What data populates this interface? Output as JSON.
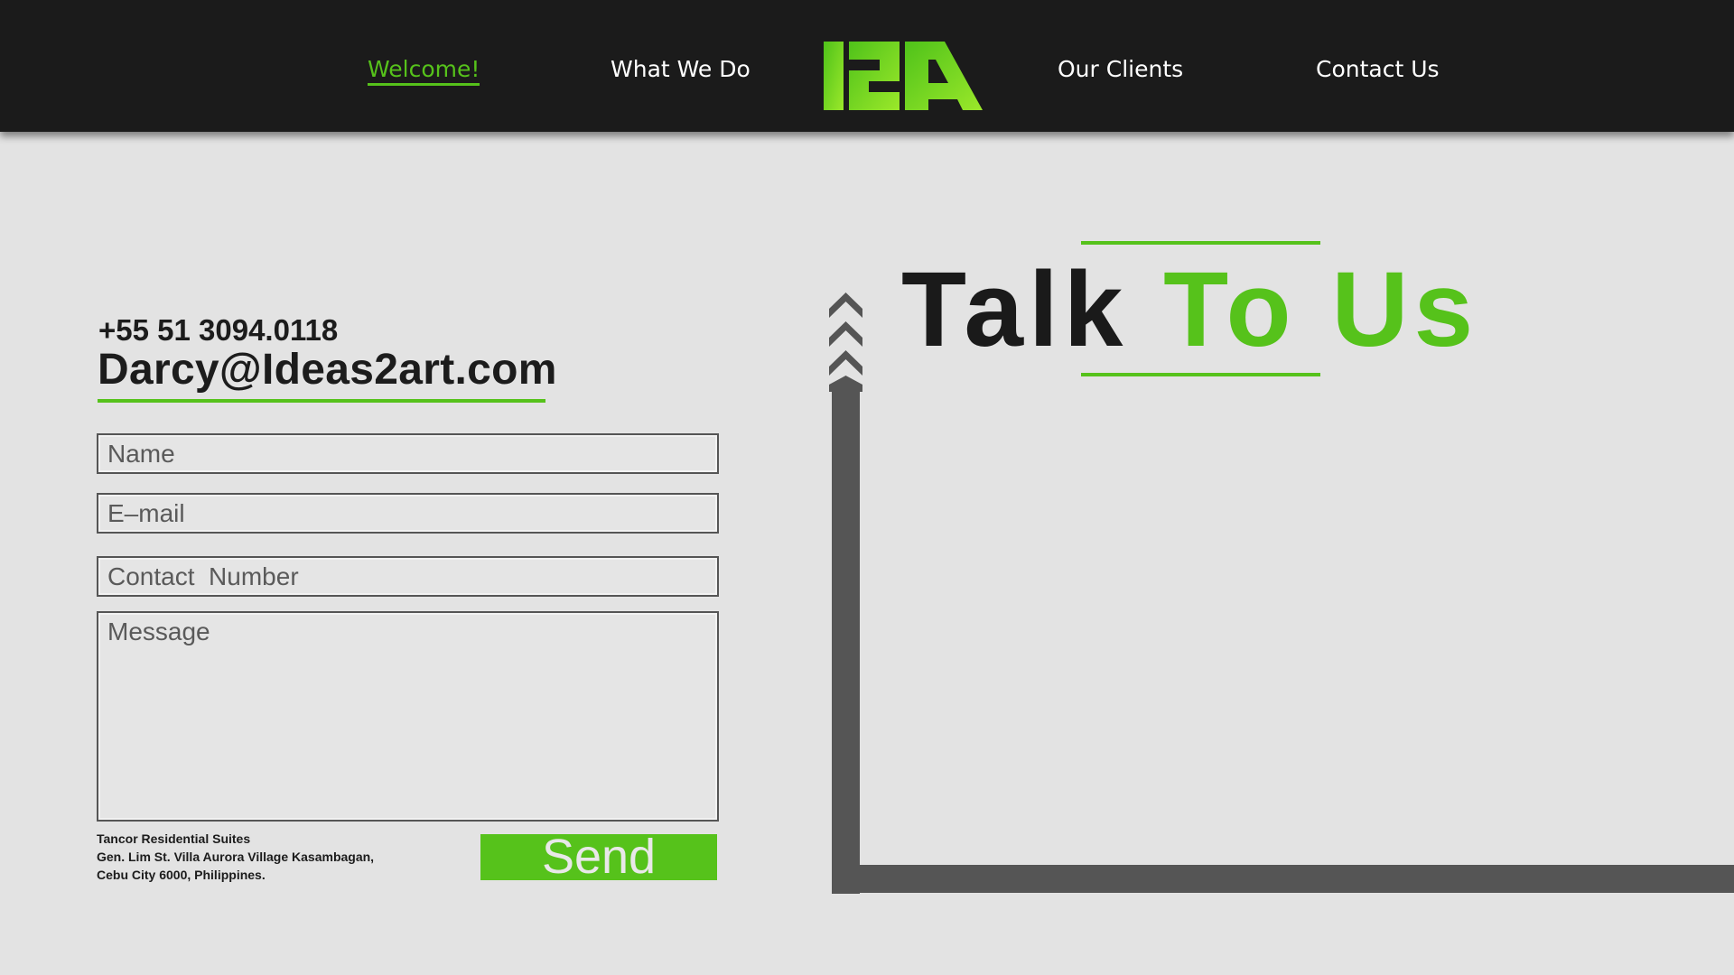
{
  "nav": {
    "items": [
      {
        "label": "Welcome!",
        "active": true
      },
      {
        "label": "What We Do",
        "active": false
      },
      {
        "label": "Our Clients",
        "active": false
      },
      {
        "label": "Contact Us",
        "active": false
      }
    ],
    "logo_text": "I2A"
  },
  "contact": {
    "phone": "+55 51 3094.0118",
    "email": "Darcy@Ideas2art.com"
  },
  "form": {
    "name_placeholder": "Name",
    "email_placeholder": "E–mail",
    "contact_placeholder": "Contact  Number",
    "message_placeholder": "Message",
    "send_label": "Send"
  },
  "address": {
    "line1": "Tancor Residential Suites",
    "line2": "Gen. Lim St. Villa Aurora Village Kasambagan,",
    "line3": "Cebu City 6000, Philippines."
  },
  "heading": {
    "part1": "Talk ",
    "part2": "To Us"
  },
  "colors": {
    "accent": "#56c21b",
    "header_bg": "#1b1b1b",
    "page_bg": "#e3e3e3",
    "frame": "#555555"
  },
  "icons": {
    "chevrons": "triple-chevron-up-icon"
  }
}
